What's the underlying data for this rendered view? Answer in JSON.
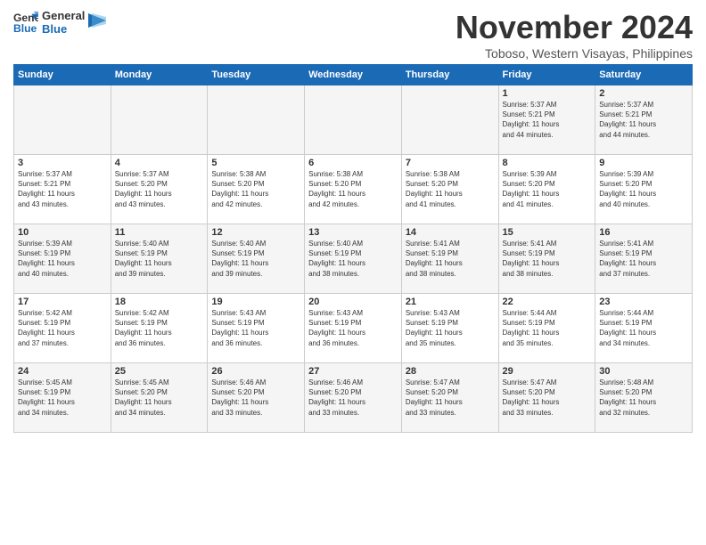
{
  "logo": {
    "line1": "General",
    "line2": "Blue"
  },
  "title": "November 2024",
  "subtitle": "Toboso, Western Visayas, Philippines",
  "days_header": [
    "Sunday",
    "Monday",
    "Tuesday",
    "Wednesday",
    "Thursday",
    "Friday",
    "Saturday"
  ],
  "weeks": [
    [
      {
        "day": "",
        "info": ""
      },
      {
        "day": "",
        "info": ""
      },
      {
        "day": "",
        "info": ""
      },
      {
        "day": "",
        "info": ""
      },
      {
        "day": "",
        "info": ""
      },
      {
        "day": "1",
        "info": "Sunrise: 5:37 AM\nSunset: 5:21 PM\nDaylight: 11 hours\nand 44 minutes."
      },
      {
        "day": "2",
        "info": "Sunrise: 5:37 AM\nSunset: 5:21 PM\nDaylight: 11 hours\nand 44 minutes."
      }
    ],
    [
      {
        "day": "3",
        "info": "Sunrise: 5:37 AM\nSunset: 5:21 PM\nDaylight: 11 hours\nand 43 minutes."
      },
      {
        "day": "4",
        "info": "Sunrise: 5:37 AM\nSunset: 5:20 PM\nDaylight: 11 hours\nand 43 minutes."
      },
      {
        "day": "5",
        "info": "Sunrise: 5:38 AM\nSunset: 5:20 PM\nDaylight: 11 hours\nand 42 minutes."
      },
      {
        "day": "6",
        "info": "Sunrise: 5:38 AM\nSunset: 5:20 PM\nDaylight: 11 hours\nand 42 minutes."
      },
      {
        "day": "7",
        "info": "Sunrise: 5:38 AM\nSunset: 5:20 PM\nDaylight: 11 hours\nand 41 minutes."
      },
      {
        "day": "8",
        "info": "Sunrise: 5:39 AM\nSunset: 5:20 PM\nDaylight: 11 hours\nand 41 minutes."
      },
      {
        "day": "9",
        "info": "Sunrise: 5:39 AM\nSunset: 5:20 PM\nDaylight: 11 hours\nand 40 minutes."
      }
    ],
    [
      {
        "day": "10",
        "info": "Sunrise: 5:39 AM\nSunset: 5:19 PM\nDaylight: 11 hours\nand 40 minutes."
      },
      {
        "day": "11",
        "info": "Sunrise: 5:40 AM\nSunset: 5:19 PM\nDaylight: 11 hours\nand 39 minutes."
      },
      {
        "day": "12",
        "info": "Sunrise: 5:40 AM\nSunset: 5:19 PM\nDaylight: 11 hours\nand 39 minutes."
      },
      {
        "day": "13",
        "info": "Sunrise: 5:40 AM\nSunset: 5:19 PM\nDaylight: 11 hours\nand 38 minutes."
      },
      {
        "day": "14",
        "info": "Sunrise: 5:41 AM\nSunset: 5:19 PM\nDaylight: 11 hours\nand 38 minutes."
      },
      {
        "day": "15",
        "info": "Sunrise: 5:41 AM\nSunset: 5:19 PM\nDaylight: 11 hours\nand 38 minutes."
      },
      {
        "day": "16",
        "info": "Sunrise: 5:41 AM\nSunset: 5:19 PM\nDaylight: 11 hours\nand 37 minutes."
      }
    ],
    [
      {
        "day": "17",
        "info": "Sunrise: 5:42 AM\nSunset: 5:19 PM\nDaylight: 11 hours\nand 37 minutes."
      },
      {
        "day": "18",
        "info": "Sunrise: 5:42 AM\nSunset: 5:19 PM\nDaylight: 11 hours\nand 36 minutes."
      },
      {
        "day": "19",
        "info": "Sunrise: 5:43 AM\nSunset: 5:19 PM\nDaylight: 11 hours\nand 36 minutes."
      },
      {
        "day": "20",
        "info": "Sunrise: 5:43 AM\nSunset: 5:19 PM\nDaylight: 11 hours\nand 36 minutes."
      },
      {
        "day": "21",
        "info": "Sunrise: 5:43 AM\nSunset: 5:19 PM\nDaylight: 11 hours\nand 35 minutes."
      },
      {
        "day": "22",
        "info": "Sunrise: 5:44 AM\nSunset: 5:19 PM\nDaylight: 11 hours\nand 35 minutes."
      },
      {
        "day": "23",
        "info": "Sunrise: 5:44 AM\nSunset: 5:19 PM\nDaylight: 11 hours\nand 34 minutes."
      }
    ],
    [
      {
        "day": "24",
        "info": "Sunrise: 5:45 AM\nSunset: 5:19 PM\nDaylight: 11 hours\nand 34 minutes."
      },
      {
        "day": "25",
        "info": "Sunrise: 5:45 AM\nSunset: 5:20 PM\nDaylight: 11 hours\nand 34 minutes."
      },
      {
        "day": "26",
        "info": "Sunrise: 5:46 AM\nSunset: 5:20 PM\nDaylight: 11 hours\nand 33 minutes."
      },
      {
        "day": "27",
        "info": "Sunrise: 5:46 AM\nSunset: 5:20 PM\nDaylight: 11 hours\nand 33 minutes."
      },
      {
        "day": "28",
        "info": "Sunrise: 5:47 AM\nSunset: 5:20 PM\nDaylight: 11 hours\nand 33 minutes."
      },
      {
        "day": "29",
        "info": "Sunrise: 5:47 AM\nSunset: 5:20 PM\nDaylight: 11 hours\nand 33 minutes."
      },
      {
        "day": "30",
        "info": "Sunrise: 5:48 AM\nSunset: 5:20 PM\nDaylight: 11 hours\nand 32 minutes."
      }
    ]
  ]
}
